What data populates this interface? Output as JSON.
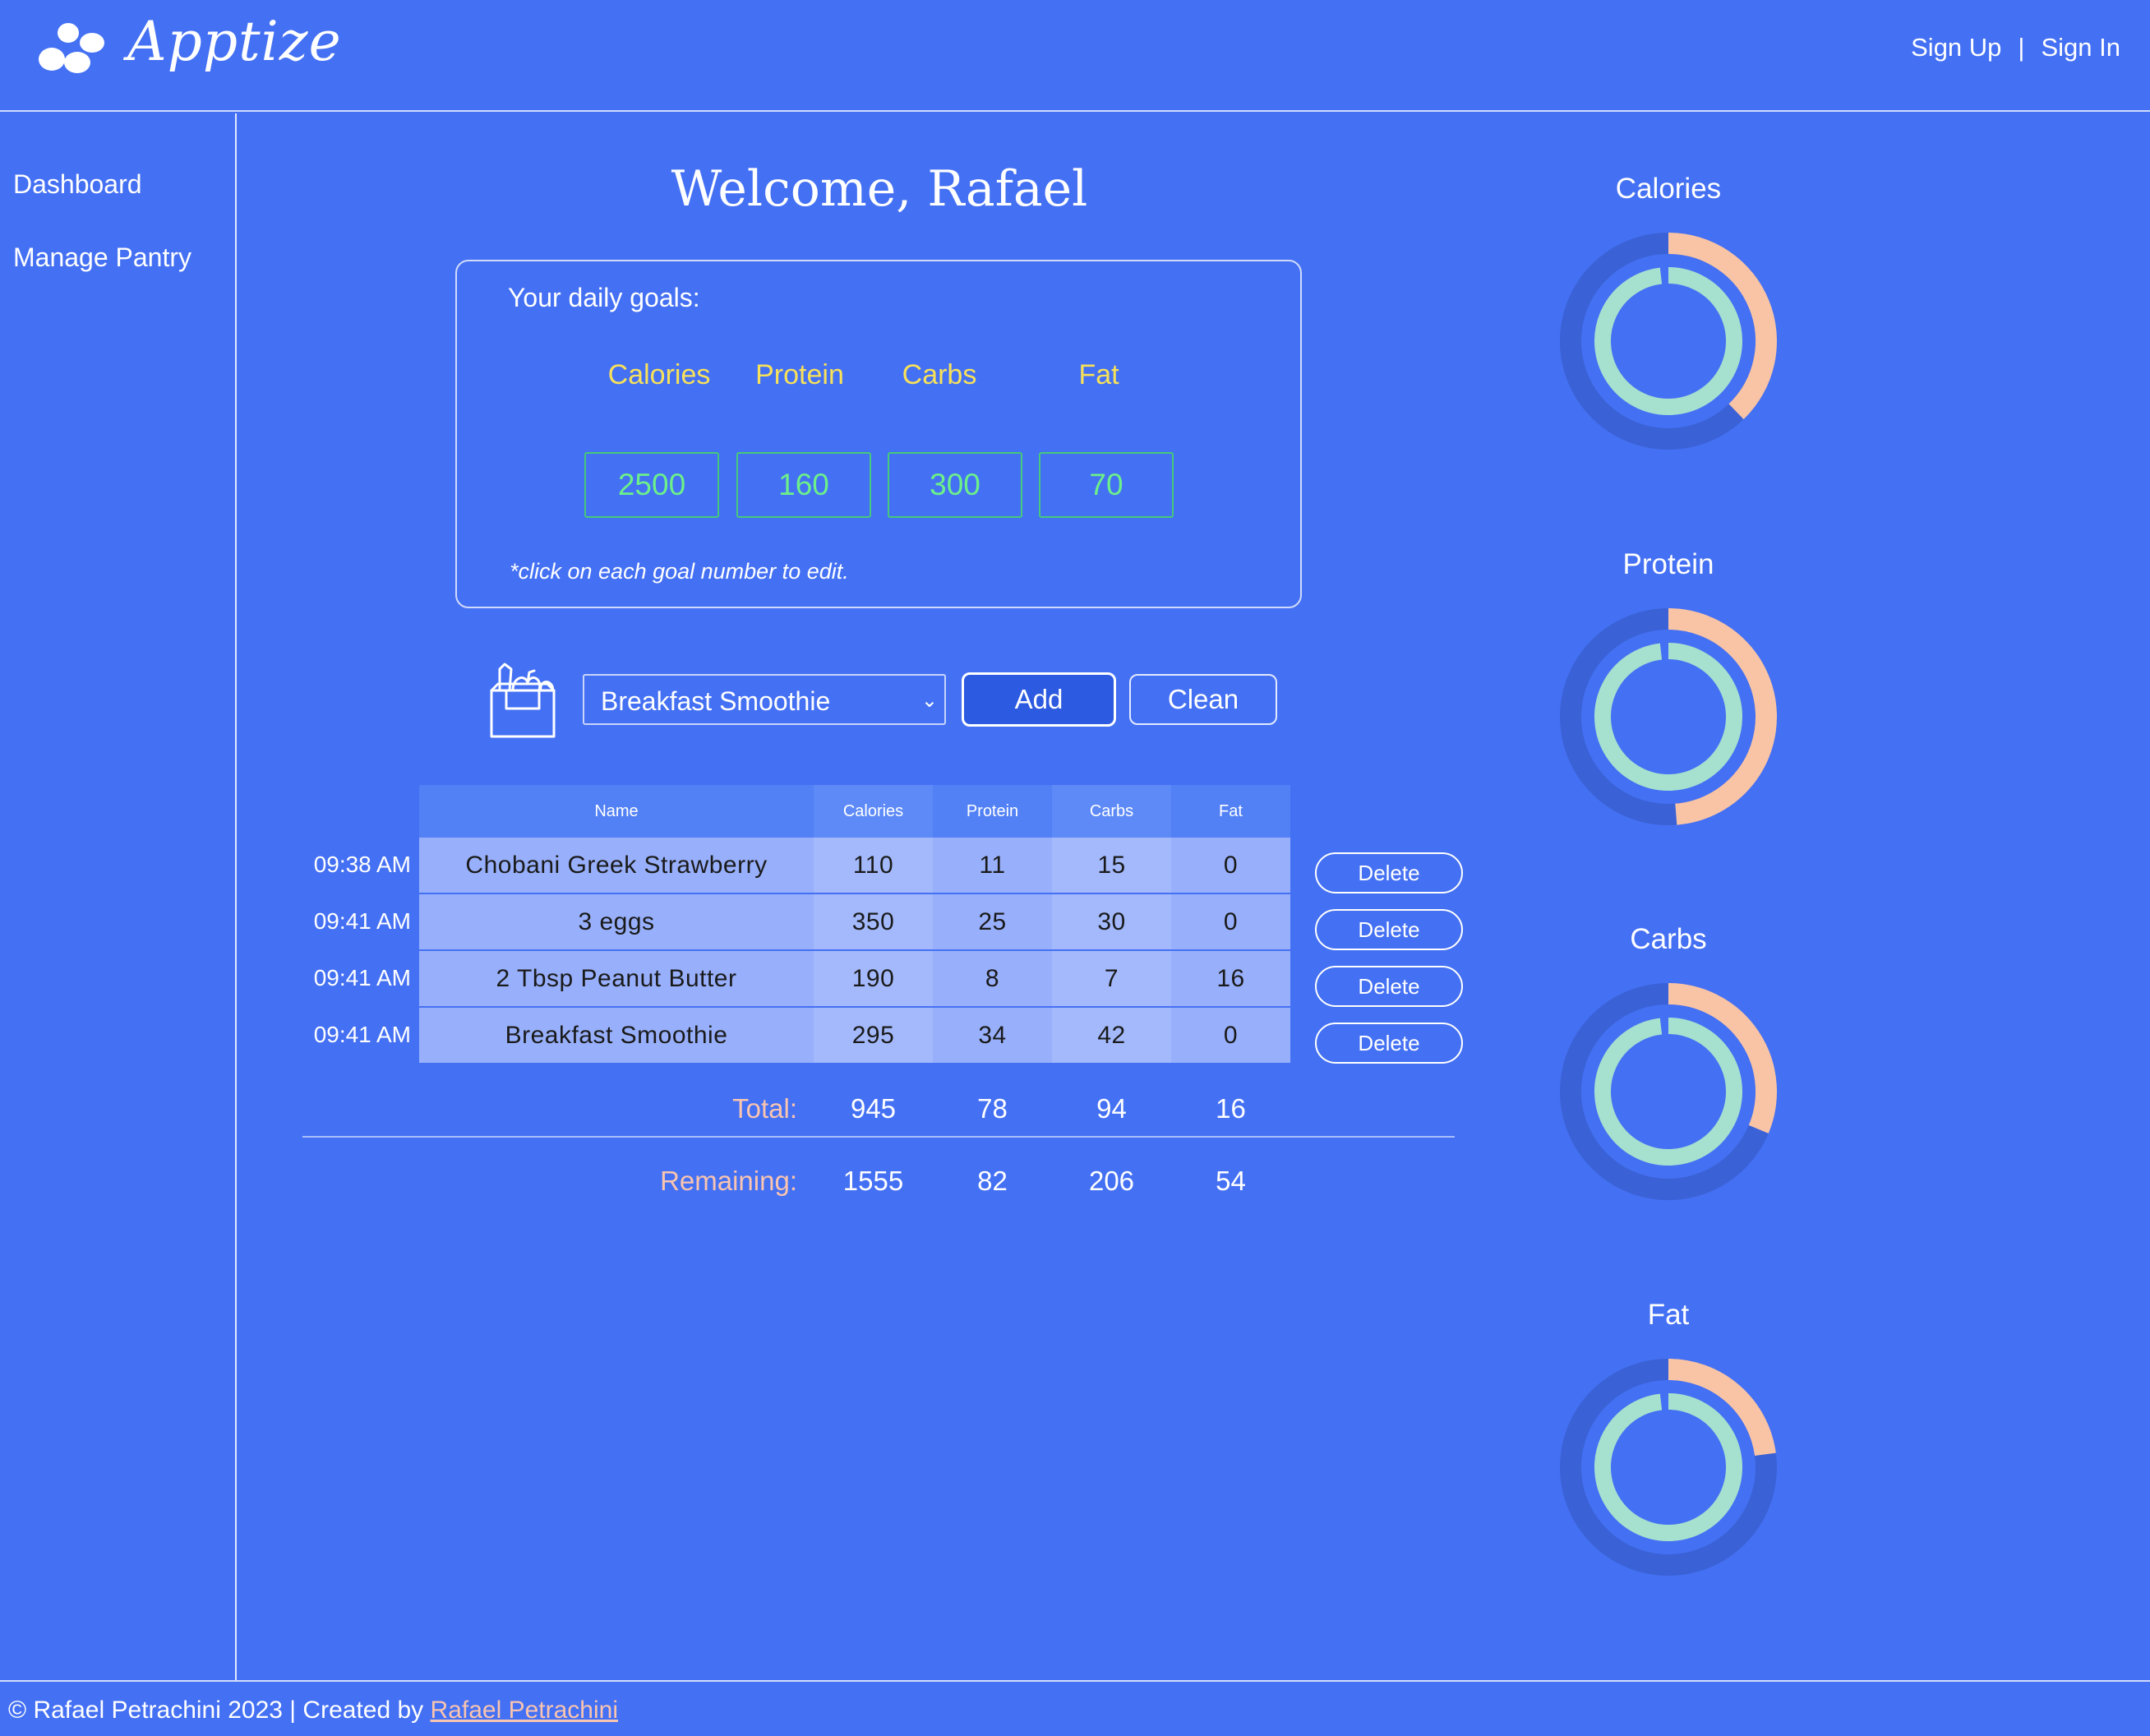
{
  "header": {
    "brand": "Apptize",
    "sign_up": "Sign Up",
    "separator": "|",
    "sign_in": "Sign In"
  },
  "sidebar": {
    "items": [
      {
        "label": "Dashboard"
      },
      {
        "label": "Manage Pantry"
      }
    ]
  },
  "main": {
    "welcome": "Welcome, Rafael",
    "goals": {
      "title": "Your daily goals:",
      "headers": [
        "Calories",
        "Protein",
        "Carbs",
        "Fat"
      ],
      "values": [
        "2500",
        "160",
        "300",
        "70"
      ],
      "note": "*click on each goal number to edit."
    },
    "add_row": {
      "icon": "grocery-bag-icon",
      "selected_food": "Breakfast Smoothie",
      "add_label": "Add",
      "clean_label": "Clean"
    },
    "table": {
      "columns": [
        "Name",
        "Calories",
        "Protein",
        "Carbs",
        "Fat"
      ],
      "rows": [
        {
          "time": "09:38 AM",
          "name": "Chobani Greek Strawberry",
          "calories": "110",
          "protein": "11",
          "carbs": "15",
          "fat": "0",
          "delete": "Delete"
        },
        {
          "time": "09:41 AM",
          "name": "3 eggs",
          "calories": "350",
          "protein": "25",
          "carbs": "30",
          "fat": "0",
          "delete": "Delete"
        },
        {
          "time": "09:41 AM",
          "name": "2 Tbsp Peanut Butter",
          "calories": "190",
          "protein": "8",
          "carbs": "7",
          "fat": "16",
          "delete": "Delete"
        },
        {
          "time": "09:41 AM",
          "name": "Breakfast Smoothie",
          "calories": "295",
          "protein": "34",
          "carbs": "42",
          "fat": "0",
          "delete": "Delete"
        }
      ],
      "total": {
        "label": "Total:",
        "calories": "945",
        "protein": "78",
        "carbs": "94",
        "fat": "16"
      },
      "remaining": {
        "label": "Remaining:",
        "calories": "1555",
        "protein": "82",
        "carbs": "206",
        "fat": "54"
      }
    }
  },
  "rings": {
    "colors": {
      "outer_track": "#3A62D6",
      "outer_progress": "#F9C4A6",
      "inner": "#A6E0CF"
    },
    "items": [
      {
        "title": "Calories",
        "progress": 0.378
      },
      {
        "title": "Protein",
        "progress": 0.4875
      },
      {
        "title": "Carbs",
        "progress": 0.313
      },
      {
        "title": "Fat",
        "progress": 0.229
      }
    ]
  },
  "footer": {
    "text": "© Rafael Petrachini 2023 | Created by",
    "link": "Rafael Petrachini"
  }
}
